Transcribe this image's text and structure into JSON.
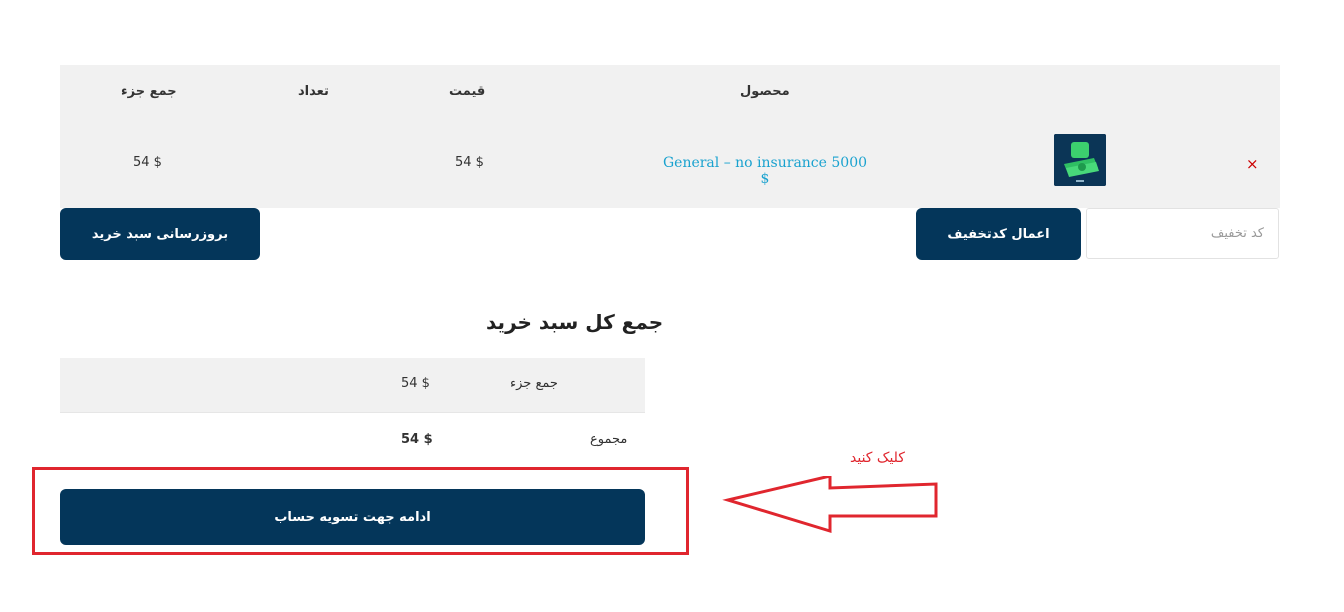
{
  "cart": {
    "headers": {
      "product": "محصول",
      "price": "قیمت",
      "quantity": "تعداد",
      "subtotal": "جمع جزء"
    },
    "items": [
      {
        "remove": "×",
        "name": "General – no insurance 5000 $",
        "price": "54 $",
        "subtotal": "54 $"
      }
    ],
    "coupon": {
      "placeholder": "کد تخفیف",
      "apply_label": "اعمال کدتخفیف"
    },
    "update_label": "بروزرسانی سبد خرید"
  },
  "totals": {
    "title": "جمع کل سبد خرید",
    "subtotal_label": "جمع جزء",
    "subtotal_value": "54 $",
    "total_label": "مجموع",
    "total_value": "54 $"
  },
  "checkout_label": "ادامه جهت تسویه حساب",
  "annotation": {
    "text": "کلیک کنید",
    "color": "#e0262e"
  },
  "colors": {
    "primary_button": "#04365a",
    "link": "#1aa2cf",
    "table_bg": "#f1f1f1"
  }
}
